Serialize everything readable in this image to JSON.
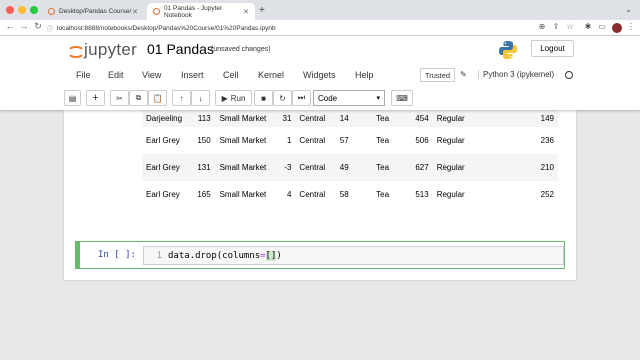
{
  "browser": {
    "tabs": [
      {
        "title": "Desktop/Pandas Course/",
        "active": false
      },
      {
        "title": "01 Pandas - Jupyter Notebook",
        "active": true
      }
    ],
    "url": "localhost:8888/notebooks/Desktop/Pandas%20Course/01%20Pandas.ipynb"
  },
  "header": {
    "logo_text": "jupyter",
    "notebook_title": "01 Pandas",
    "save_status": "(unsaved changes)",
    "logout_label": "Logout"
  },
  "menu": {
    "items": [
      "File",
      "Edit",
      "View",
      "Insert",
      "Cell",
      "Kernel",
      "Widgets",
      "Help"
    ],
    "trusted_label": "Trusted",
    "kernel_name": "Python 3 (ipykernel)"
  },
  "toolbar": {
    "run_label": "Run",
    "cell_type": "Code"
  },
  "dataframe": {
    "rows": [
      [
        "Darjeeling",
        "113",
        "Small Market",
        "31",
        "Central",
        "14",
        "Tea",
        "454",
        "Regular",
        "149"
      ],
      [
        "Earl Grey",
        "150",
        "Small Market",
        "1",
        "Central",
        "57",
        "Tea",
        "506",
        "Regular",
        "236"
      ],
      [
        "Earl Grey",
        "131",
        "Small Market",
        "-3",
        "Central",
        "49",
        "Tea",
        "627",
        "Regular",
        "210"
      ],
      [
        "Earl Grey",
        "165",
        "Small Market",
        "4",
        "Central",
        "58",
        "Tea",
        "513",
        "Regular",
        "252"
      ]
    ]
  },
  "cell": {
    "prompt": "In [ ]:",
    "line_number": "1",
    "code_prefix": "data.drop(columns",
    "code_op": "=",
    "code_brackets": "[]",
    "code_suffix": ")"
  },
  "colors": {
    "jupyter_orange": "#f37726",
    "cell_border_edit": "#66bb6a",
    "prompt_blue": "#303f9f"
  }
}
